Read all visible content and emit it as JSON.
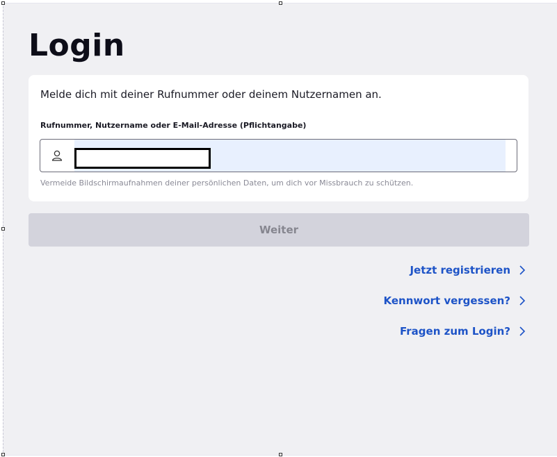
{
  "page": {
    "title": "Login"
  },
  "card": {
    "intro": "Melde dich mit deiner Rufnummer oder deinem Nutzernamen an.",
    "field_label": "Rufnummer, Nutzername oder E-Mail-Adresse (Pflichtangabe)",
    "field_value": "",
    "field_icon": "user-icon",
    "hint": "Vermeide Bildschirmaufnahmen deiner persönlichen Daten, um dich vor Missbrauch zu schützen."
  },
  "actions": {
    "submit_label": "Weiter"
  },
  "links": [
    {
      "label": "Jetzt registrieren",
      "icon": "chevron-right-icon"
    },
    {
      "label": "Kennwort vergessen?",
      "icon": "chevron-right-icon"
    },
    {
      "label": "Fragen zum Login?",
      "icon": "chevron-right-icon"
    }
  ],
  "colors": {
    "background": "#f0f0f3",
    "card": "#ffffff",
    "link": "#1d53c7",
    "button_disabled": "#d3d3dc",
    "autofill": "#e8f0fe"
  }
}
